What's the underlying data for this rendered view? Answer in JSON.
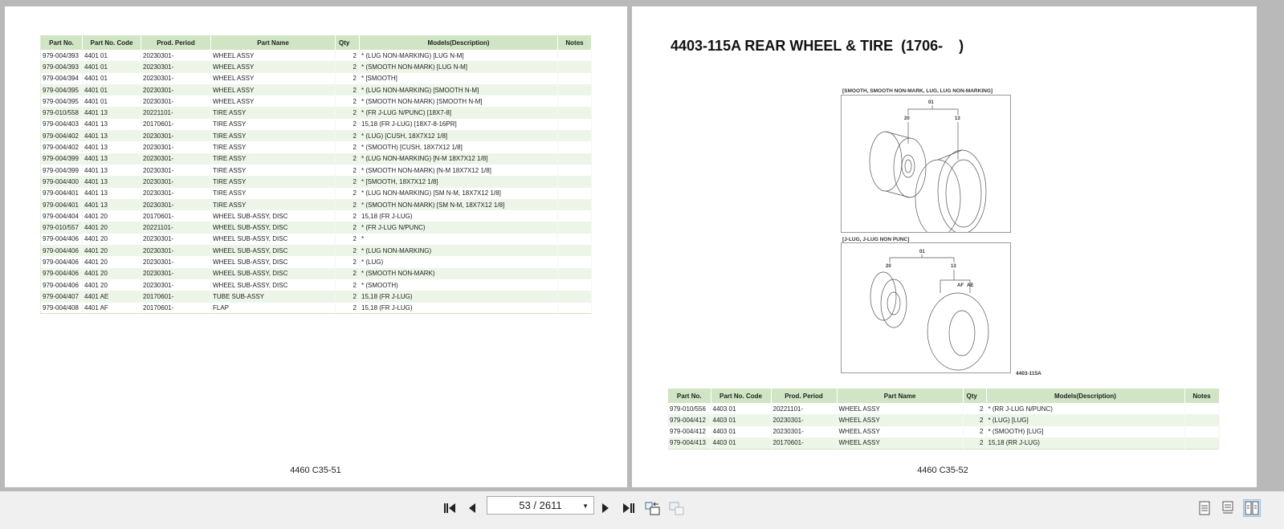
{
  "columns": [
    "Part No.",
    "Part No. Code",
    "Prod. Period",
    "Part Name",
    "Qty",
    "Models(Description)",
    "Notes"
  ],
  "left_page": {
    "footer": "4460 C35-51",
    "rows": [
      [
        "979-004/393",
        "4401 01",
        "20230301-",
        "WHEEL ASSY",
        "2",
        "* (LUG NON-MARKING) [LUG N-M]",
        ""
      ],
      [
        "979-004/393",
        "4401 01",
        "20230301-",
        "WHEEL ASSY",
        "2",
        "* (SMOOTH NON-MARK) [LUG N-M]",
        ""
      ],
      [
        "979-004/394",
        "4401 01",
        "20230301-",
        "WHEEL ASSY",
        "2",
        "* [SMOOTH]",
        ""
      ],
      [
        "979-004/395",
        "4401 01",
        "20230301-",
        "WHEEL ASSY",
        "2",
        "* (LUG NON-MARKING) [SMOOTH N-M]",
        ""
      ],
      [
        "979-004/395",
        "4401 01",
        "20230301-",
        "WHEEL ASSY",
        "2",
        "* (SMOOTH NON-MARK) [SMOOTH N-M]",
        ""
      ],
      [
        "979-010/558",
        "4401 13",
        "20221101-",
        "TIRE ASSY",
        "2",
        "* (FR J-LUG N/PUNC) [18X7-8]",
        ""
      ],
      [
        "979-004/403",
        "4401 13",
        "20170601-",
        "TIRE ASSY",
        "2",
        "15,18 (FR J-LUG) [18X7-8-16PR]",
        ""
      ],
      [
        "979-004/402",
        "4401 13",
        "20230301-",
        "TIRE ASSY",
        "2",
        "* (LUG) [CUSH, 18X7X12 1/8]",
        ""
      ],
      [
        "979-004/402",
        "4401 13",
        "20230301-",
        "TIRE ASSY",
        "2",
        "* (SMOOTH) [CUSH, 18X7X12 1/8]",
        ""
      ],
      [
        "979-004/399",
        "4401 13",
        "20230301-",
        "TIRE ASSY",
        "2",
        "* (LUG NON-MARKING) [N-M 18X7X12 1/8]",
        ""
      ],
      [
        "979-004/399",
        "4401 13",
        "20230301-",
        "TIRE ASSY",
        "2",
        "* (SMOOTH NON-MARK) [N-M 18X7X12 1/8]",
        ""
      ],
      [
        "979-004/400",
        "4401 13",
        "20230301-",
        "TIRE ASSY",
        "2",
        "* [SMOOTH, 18X7X12 1/8]",
        ""
      ],
      [
        "979-004/401",
        "4401 13",
        "20230301-",
        "TIRE ASSY",
        "2",
        "* (LUG NON-MARKING) [SM N-M, 18X7X12 1/8]",
        ""
      ],
      [
        "979-004/401",
        "4401 13",
        "20230301-",
        "TIRE ASSY",
        "2",
        "* (SMOOTH NON-MARK) [SM N-M, 18X7X12 1/8]",
        ""
      ],
      [
        "979-004/404",
        "4401 20",
        "20170601-",
        "WHEEL SUB-ASSY, DISC",
        "2",
        "15,18 (FR J-LUG)",
        ""
      ],
      [
        "979-010/557",
        "4401 20",
        "20221101-",
        "WHEEL SUB-ASSY, DISC",
        "2",
        "* (FR J-LUG N/PUNC)",
        ""
      ],
      [
        "979-004/406",
        "4401 20",
        "20230301-",
        "WHEEL SUB-ASSY, DISC",
        "2",
        "*",
        ""
      ],
      [
        "979-004/406",
        "4401 20",
        "20230301-",
        "WHEEL SUB-ASSY, DISC",
        "2",
        "* (LUG NON-MARKING)",
        ""
      ],
      [
        "979-004/406",
        "4401 20",
        "20230301-",
        "WHEEL SUB-ASSY, DISC",
        "2",
        "* (LUG)",
        ""
      ],
      [
        "979-004/406",
        "4401 20",
        "20230301-",
        "WHEEL SUB-ASSY, DISC",
        "2",
        "* (SMOOTH NON-MARK)",
        ""
      ],
      [
        "979-004/406",
        "4401 20",
        "20230301-",
        "WHEEL SUB-ASSY, DISC",
        "2",
        "* (SMOOTH)",
        ""
      ],
      [
        "979-004/407",
        "4401 AE",
        "20170601-",
        "TUBE SUB-ASSY",
        "2",
        "15,18 (FR J-LUG)",
        ""
      ],
      [
        "979-004/408",
        "4401 AF",
        "20170601-",
        "FLAP",
        "2",
        "15,18 (FR J-LUG)",
        ""
      ]
    ]
  },
  "right_page": {
    "title": "4403-115A REAR WHEEL & TIRE  (1706-    )",
    "diagram": {
      "top_caption": "[SMOOTH, SMOOTH NON-MARK, LUG, LUG NON-MARKING]",
      "bottom_caption": "[J-LUG, J-LUG NON PUNC]",
      "callouts": [
        "01",
        "20",
        "13",
        "AF",
        "AE"
      ],
      "figure_id": "4403-115A"
    },
    "footer": "4460 C35-52",
    "rows": [
      [
        "979-010/556",
        "4403 01",
        "20221101-",
        "WHEEL ASSY",
        "2",
        "* (RR J-LUG N/PUNC)",
        ""
      ],
      [
        "979-004/412",
        "4403 01",
        "20230301-",
        "WHEEL ASSY",
        "2",
        "* (LUG) [LUG]",
        ""
      ],
      [
        "979-004/412",
        "4403 01",
        "20230301-",
        "WHEEL ASSY",
        "2",
        "* (SMOOTH) [LUG]",
        ""
      ],
      [
        "979-004/413",
        "4403 01",
        "20170601-",
        "WHEEL ASSY",
        "2",
        "15,18 (RR J-LUG)",
        ""
      ]
    ]
  },
  "toolbar": {
    "page_indicator": "53 / 2611",
    "selected_view": "two-page"
  }
}
